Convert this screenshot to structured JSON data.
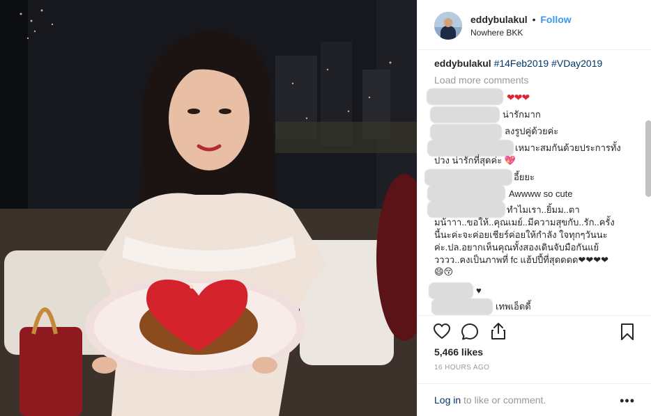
{
  "header": {
    "username": "eddybulakul",
    "separator": "•",
    "follow_label": "Follow",
    "location": "Nowhere BKK"
  },
  "caption": {
    "username": "eddybulakul",
    "tags": "#14Feb2019 #VDay2019"
  },
  "load_more_label": "Load more comments",
  "comments": [
    {
      "text": "❤❤❤"
    },
    {
      "text": "น่ารักมาก"
    },
    {
      "text": "ลงรูปคู่ด้วยค่ะ"
    },
    {
      "text": "เหมาะสมกันด้วยประการทั้ง"
    },
    {
      "text": "ปวง น่ารักที่สุดค่ะ 💖"
    },
    {
      "text": "อี้ยยะ"
    },
    {
      "text": "Awwww so cute"
    },
    {
      "text": "ทำไมเรา..ยิ้มม..ตา"
    },
    {
      "text": "มน้าาา..ขอให้..คุณเมย์..มีความสุขกับ..รัก..ครั้ง"
    },
    {
      "text": "นี้นะค่ะจะค่อยเชียร์ค่อยให้กำลัง ใจทุกๆวันนะ"
    },
    {
      "text": "ค่ะ.ปล.อยากเห็นคุณทั้งสองเดินจับมือกันแย้"
    },
    {
      "text": "วววว..คงเป็นภาพที่ fc แฮ้ปปี้ที่สุดดดด❤❤❤❤"
    },
    {
      "text": "😄😚"
    },
    {
      "text": "♥"
    },
    {
      "text": "เทพเอ็ดดี้"
    }
  ],
  "icons": {
    "like": "heart-icon",
    "comment": "comment-bubble-icon",
    "share": "share-icon",
    "save": "bookmark-icon",
    "more": "more-dots-icon"
  },
  "likes": "5,466 likes",
  "time_ago": "16 HOURS AGO",
  "login": {
    "link": "Log in",
    "rest": " to like or comment."
  },
  "more_label": "•••"
}
